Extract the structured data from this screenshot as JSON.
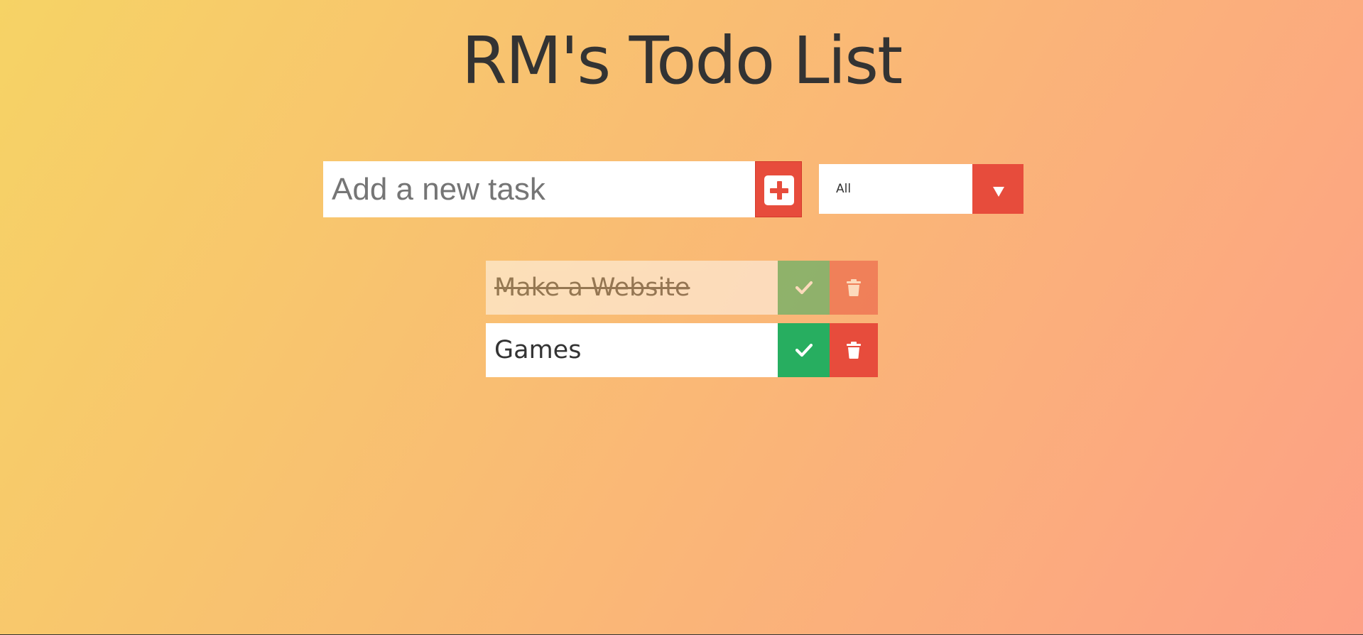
{
  "app": {
    "title": "RM's Todo List"
  },
  "form": {
    "input_placeholder": "Add a new task",
    "input_value": "",
    "add_icon": "plus-square-icon"
  },
  "filter": {
    "selected": "All",
    "arrow_icon": "caret-down-icon"
  },
  "todos": [
    {
      "text": "Make a Website",
      "completed": true
    },
    {
      "text": "Games",
      "completed": false
    }
  ],
  "icons": {
    "complete": "check-icon",
    "delete": "trash-icon"
  },
  "colors": {
    "gradient_start": "#f6d365",
    "gradient_end": "#fda085",
    "accent_red": "#e74c3c",
    "complete_green": "#27ae60",
    "text": "#333333"
  }
}
